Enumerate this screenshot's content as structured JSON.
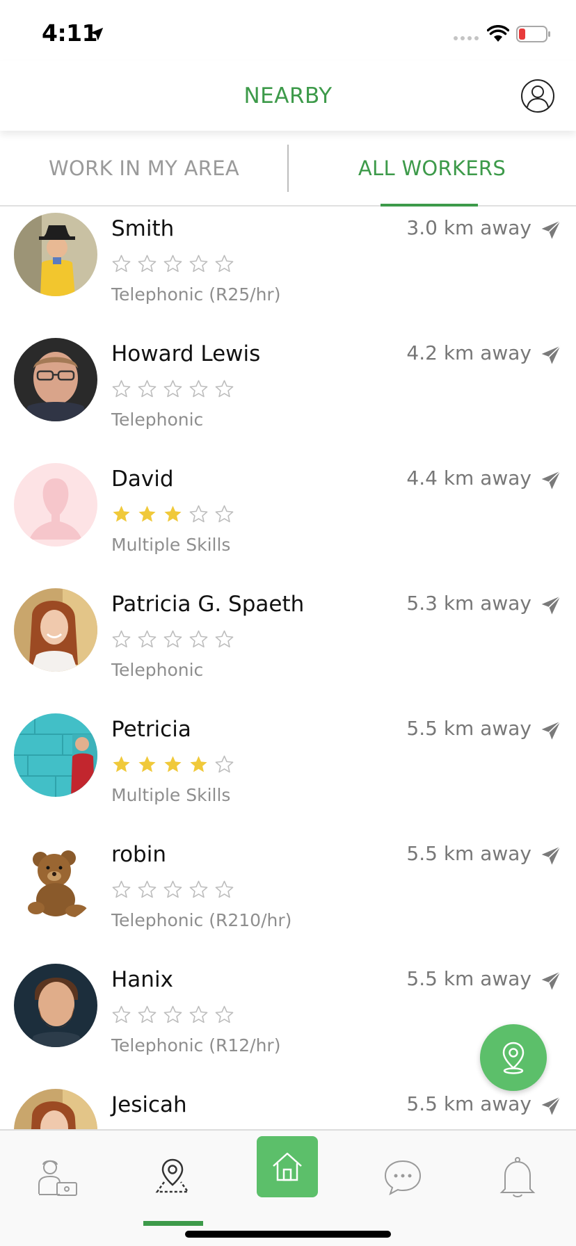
{
  "status_bar": {
    "time": "4:11"
  },
  "header": {
    "title": "NEARBY"
  },
  "tabs": {
    "left": "WORK IN MY AREA",
    "right": "ALL WORKERS",
    "active": "ALL WORKERS"
  },
  "workers": [
    {
      "name": "Smith",
      "distance": "3.0 km away",
      "rating": 0,
      "skill": "Telephonic (R25/hr)",
      "avatar_icon": "boy-in-hat-photo"
    },
    {
      "name": "Howard Lewis",
      "distance": "4.2 km away",
      "rating": 0,
      "skill": "Telephonic",
      "avatar_icon": "man-with-glasses-photo"
    },
    {
      "name": "David",
      "distance": "4.4 km away",
      "rating": 3,
      "skill": "Multiple Skills",
      "avatar_icon": "default-silhouette"
    },
    {
      "name": "Patricia G. Spaeth",
      "distance": "5.3 km away",
      "rating": 0,
      "skill": "Telephonic",
      "avatar_icon": "red-haired-woman-photo"
    },
    {
      "name": "Petricia",
      "distance": "5.5 km away",
      "rating": 4,
      "skill": "Multiple Skills",
      "avatar_icon": "man-at-blue-wall-photo"
    },
    {
      "name": "robin",
      "distance": "5.5 km away",
      "rating": 0,
      "skill": "Telephonic (R210/hr)",
      "avatar_icon": "teddy-bear-photo"
    },
    {
      "name": "Hanix",
      "distance": "5.5 km away",
      "rating": 0,
      "skill": "Telephonic (R12/hr)",
      "avatar_icon": "bearded-man-photo"
    },
    {
      "name": "Jesicah",
      "distance": "5.5 km away",
      "rating": 0,
      "skill": "",
      "avatar_icon": "red-haired-woman-photo"
    }
  ],
  "bottom_nav": {
    "items": [
      "worker-profile-icon",
      "map-pin-icon",
      "home-icon",
      "chat-icon",
      "bell-icon"
    ],
    "active": "map-pin-icon"
  },
  "colors": {
    "accent": "#3d9a4a",
    "fab": "#5cbf6a",
    "star_filled": "#f0c93a",
    "star_empty": "#bcbcbc",
    "distance_text": "#777777"
  }
}
